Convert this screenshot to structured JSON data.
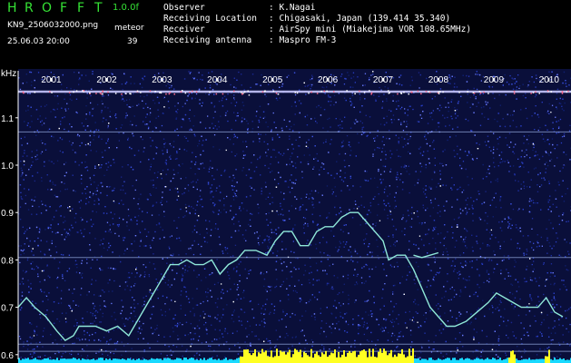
{
  "header": {
    "title_letters": [
      "H",
      "R",
      "O",
      "F",
      "F",
      "T"
    ],
    "version": "1.0.0f",
    "filename": "KN9_2506032000.png",
    "datetime": "25.06.03 20:00",
    "meteor_label": "meteor",
    "meteor_count": "39"
  },
  "info": {
    "labels": [
      "Observer",
      "Receiving Location",
      "Receiver",
      "Receiving antenna"
    ],
    "values": [
      ": K.Nagai",
      ": Chigasaki, Japan (139.414 35.340)",
      ": AirSpy mini (Miakejima VOR 108.65MHz)",
      ": Maspro FM-3"
    ]
  },
  "colors": {
    "background": "#000000",
    "title_green": "#35e335",
    "text_white": "#ffffff",
    "noise_blue": "#1e2fa0",
    "trace_cyan": "#8fe8d8",
    "bottom_cyan": "#19d9ff",
    "bottom_yellow": "#ffff22"
  },
  "chart_data": {
    "type": "line",
    "x_unit": "year",
    "y_unit": "kHz",
    "xlim": [
      2000.4,
      2010.25
    ],
    "ylim": [
      0.59,
      1.18
    ],
    "x_ticks": [
      "2001",
      "2002",
      "2003",
      "2004",
      "2005",
      "2006",
      "2007",
      "2008",
      "2009",
      "2010"
    ],
    "y_ticks": [
      "0.6",
      "0.7",
      "0.8",
      "0.9",
      "1.0",
      "1.1"
    ],
    "y_axis_label": "kHz",
    "series": [
      {
        "x": [
          2000.4,
          2000.55,
          2000.7,
          2000.9,
          2001.1,
          2001.25,
          2001.4,
          2001.5,
          2001.65,
          2001.8,
          2002.0,
          2002.2,
          2002.4,
          2002.6,
          2002.8,
          2003.0,
          2003.15,
          2003.3,
          2003.45,
          2003.6,
          2003.75,
          2003.9,
          2004.05,
          2004.2,
          2004.35,
          2004.5,
          2004.7,
          2004.9,
          2005.05,
          2005.2,
          2005.35,
          2005.5,
          2005.65,
          2005.8,
          2005.95,
          2006.1,
          2006.25,
          2006.4,
          2006.55,
          2006.7,
          2006.85,
          2007.0,
          2007.1,
          2007.25,
          2007.4,
          2007.55,
          2007.7,
          2007.85,
          2008.0,
          2008.15,
          2008.3,
          2008.5,
          2008.7,
          2008.9,
          2009.05,
          2009.2,
          2009.35,
          2009.5,
          2009.65,
          2009.8,
          2009.95,
          2010.1,
          2010.25
        ],
        "y": [
          0.7,
          0.72,
          0.7,
          0.68,
          0.65,
          0.63,
          0.64,
          0.66,
          0.66,
          0.66,
          0.65,
          0.66,
          0.64,
          0.68,
          0.72,
          0.76,
          0.79,
          0.79,
          0.8,
          0.79,
          0.79,
          0.8,
          0.77,
          0.79,
          0.8,
          0.82,
          0.82,
          0.81,
          0.84,
          0.86,
          0.86,
          0.83,
          0.83,
          0.86,
          0.87,
          0.87,
          0.89,
          0.9,
          0.9,
          0.88,
          0.86,
          0.84,
          0.8,
          0.81,
          0.81,
          0.78,
          0.74,
          0.7,
          0.68,
          0.66,
          0.66,
          0.67,
          0.69,
          0.71,
          0.73,
          0.72,
          0.71,
          0.7,
          0.7,
          0.7,
          0.72,
          0.69,
          0.68
        ]
      },
      {
        "x": [
          2007.55,
          2007.7,
          2007.85,
          2008.0
        ],
        "y": [
          0.81,
          0.805,
          0.81,
          0.815
        ]
      }
    ],
    "reference_lines_y": [
      1.155,
      1.07,
      0.805,
      0.622,
      0.607
    ],
    "grid": false
  }
}
